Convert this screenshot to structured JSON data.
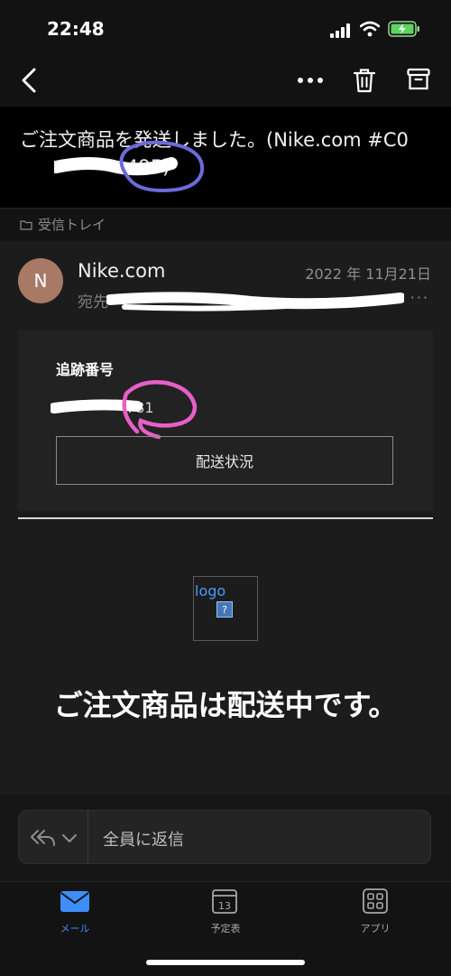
{
  "status_bar": {
    "time": "22:48"
  },
  "email": {
    "subject": "ご注文商品を発送しました。(Nike.com #C0",
    "subject_end": "495)",
    "folder": "受信トレイ",
    "sender_initial": "N",
    "sender": "Nike.com",
    "date": "2022 年 11月21日",
    "to_label": "宛先",
    "to_more": "···"
  },
  "tracking": {
    "label": "追跡番号",
    "number_visible": "781",
    "status_button": "配送状況"
  },
  "logo": {
    "alt_text": "logo",
    "broken_glyph": "?"
  },
  "headline": "ご注文商品は配送中です。",
  "reply": {
    "label": "全員に返信"
  },
  "tabs": [
    {
      "label": "メール",
      "icon": "mail-icon",
      "active": true
    },
    {
      "label": "予定表",
      "icon": "calendar-icon",
      "day": "13"
    },
    {
      "label": "アプリ",
      "icon": "apps-grid-icon"
    }
  ],
  "colors": {
    "accent": "#3e8ef7",
    "avatar": "#a87a66",
    "annotation_blue": "#6b6bdc",
    "annotation_pink": "#e85fc8"
  }
}
